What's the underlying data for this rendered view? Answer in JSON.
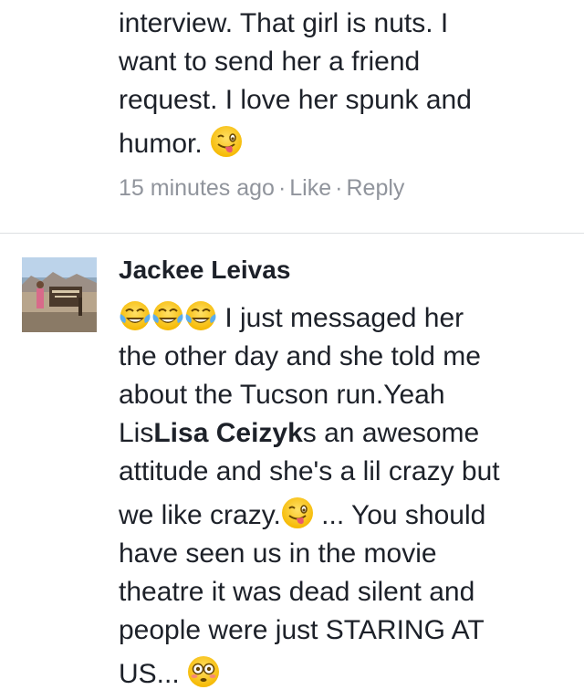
{
  "comment1": {
    "lines": [
      "interview. That girl is nuts. I",
      "want to send her a friend",
      "request. I love her spunk and",
      "humor."
    ],
    "time": "15 minutes ago",
    "like": "Like",
    "reply": "Reply",
    "separator": "·"
  },
  "comment2": {
    "author": "Jackee Leivas",
    "line1": "I just messaged her",
    "line2": "the other day and she told me",
    "line3": "about the Tucson run.Yeah",
    "line4_pre": "Lis",
    "mention": "Lisa Ceizyk",
    "line4_post": "s an awesome",
    "line5": "attitude and she's a lil crazy but",
    "line6_pre": "we like crazy.",
    "line6_post": " ... You should",
    "line7": "have seen us in the movie",
    "line8": "theatre it was dead silent and",
    "line9": "people were just STARING AT",
    "line10": "US..."
  },
  "icons": {
    "winking_tongue": "winking-face-with-tongue-icon",
    "tears_of_joy": "face-with-tears-of-joy-icon",
    "flushed": "flushed-face-icon"
  },
  "colors": {
    "text": "#1d2129",
    "meta": "#90949c",
    "divider": "#dddfe2",
    "emoji_yellow": "#ffcc33"
  }
}
